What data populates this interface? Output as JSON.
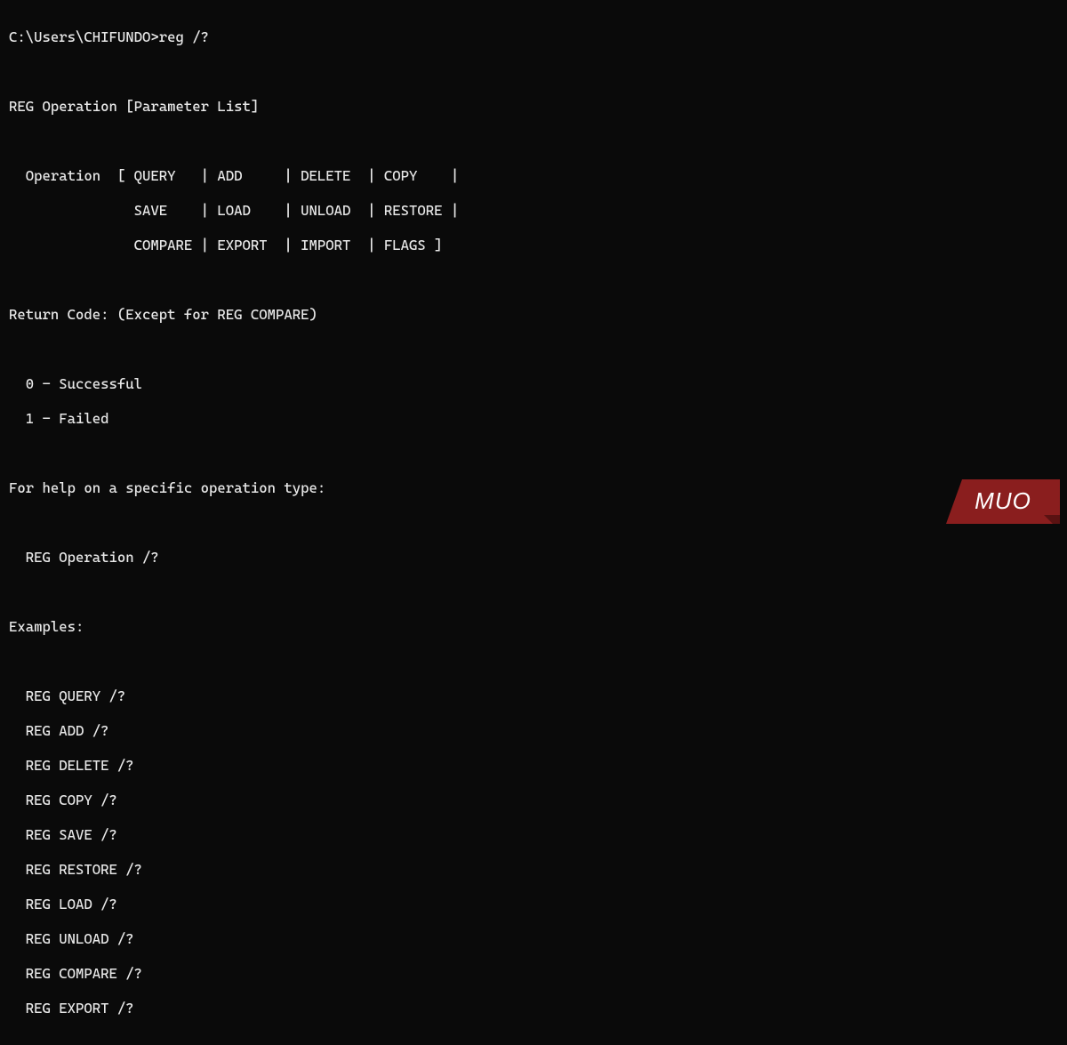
{
  "prompt": "C:\\Users\\CHIFUNDO>",
  "command": "reg /?",
  "output": {
    "usage_line": "REG Operation [Parameter List]",
    "op_row1": "  Operation  [ QUERY   | ADD     | DELETE  | COPY    |",
    "op_row2": "               SAVE    | LOAD    | UNLOAD  | RESTORE |",
    "op_row3": "               COMPARE | EXPORT  | IMPORT  | FLAGS ]",
    "return_code_header": "Return Code: (Except for REG COMPARE)",
    "rc0": "  0 - Successful",
    "rc1": "  1 - Failed",
    "help_header": "For help on a specific operation type:",
    "help_usage": "  REG Operation /?",
    "examples_header": "Examples:",
    "ex1": "  REG QUERY /?",
    "ex2": "  REG ADD /?",
    "ex3": "  REG DELETE /?",
    "ex4": "  REG COPY /?",
    "ex5": "  REG SAVE /?",
    "ex6": "  REG RESTORE /?",
    "ex7": "  REG LOAD /?",
    "ex8": "  REG UNLOAD /?",
    "ex9": "  REG COMPARE /?",
    "ex10": "  REG EXPORT /?"
  },
  "watermark": {
    "text": "MUO",
    "bg_color": "#8a1e1e",
    "text_color": "#ffffff"
  }
}
